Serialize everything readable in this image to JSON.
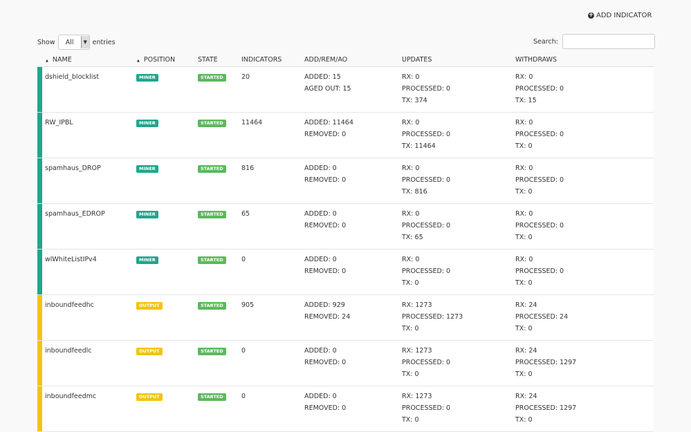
{
  "toolbar": {
    "add_indicator": "ADD INDICATOR",
    "show": "Show",
    "entries": "entries",
    "length_value": "All",
    "search_label": "Search:",
    "search_value": ""
  },
  "columns": [
    "NAME",
    "POSITION",
    "STATE",
    "INDICATORS",
    "ADD/REM/AO",
    "UPDATES",
    "WITHDRAWS"
  ],
  "colors": {
    "miner": "#1fa68b",
    "output": "#f2c40f",
    "started": "#5cb85c"
  },
  "rows": [
    {
      "name": "dshield_blocklist",
      "position": "MINER",
      "state": "STARTED",
      "indicators": "20",
      "addrem": [
        "ADDED: 15",
        "AGED OUT: 15"
      ],
      "updates": [
        "RX: 0",
        "PROCESSED: 0",
        "TX: 374"
      ],
      "withdraws": [
        "RX: 0",
        "PROCESSED: 0",
        "TX: 15"
      ]
    },
    {
      "name": "RW_IPBL",
      "position": "MINER",
      "state": "STARTED",
      "indicators": "11464",
      "addrem": [
        "ADDED: 11464",
        "REMOVED: 0"
      ],
      "updates": [
        "RX: 0",
        "PROCESSED: 0",
        "TX: 11464"
      ],
      "withdraws": [
        "RX: 0",
        "PROCESSED: 0",
        "TX: 0"
      ]
    },
    {
      "name": "spamhaus_DROP",
      "position": "MINER",
      "state": "STARTED",
      "indicators": "816",
      "addrem": [
        "ADDED: 0",
        "REMOVED: 0"
      ],
      "updates": [
        "RX: 0",
        "PROCESSED: 0",
        "TX: 816"
      ],
      "withdraws": [
        "RX: 0",
        "PROCESSED: 0",
        "TX: 0"
      ]
    },
    {
      "name": "spamhaus_EDROP",
      "position": "MINER",
      "state": "STARTED",
      "indicators": "65",
      "addrem": [
        "ADDED: 0",
        "REMOVED: 0"
      ],
      "updates": [
        "RX: 0",
        "PROCESSED: 0",
        "TX: 65"
      ],
      "withdraws": [
        "RX: 0",
        "PROCESSED: 0",
        "TX: 0"
      ]
    },
    {
      "name": "wlWhiteListIPv4",
      "position": "MINER",
      "state": "STARTED",
      "indicators": "0",
      "addrem": [
        "ADDED: 0",
        "REMOVED: 0"
      ],
      "updates": [
        "RX: 0",
        "PROCESSED: 0",
        "TX: 0"
      ],
      "withdraws": [
        "RX: 0",
        "PROCESSED: 0",
        "TX: 0"
      ]
    },
    {
      "name": "inboundfeedhc",
      "position": "OUTPUT",
      "state": "STARTED",
      "indicators": "905",
      "addrem": [
        "ADDED: 929",
        "REMOVED: 24"
      ],
      "updates": [
        "RX: 1273",
        "PROCESSED: 1273",
        "TX: 0"
      ],
      "withdraws": [
        "RX: 24",
        "PROCESSED: 24",
        "TX: 0"
      ]
    },
    {
      "name": "inboundfeedlc",
      "position": "OUTPUT",
      "state": "STARTED",
      "indicators": "0",
      "addrem": [
        "ADDED: 0",
        "REMOVED: 0"
      ],
      "updates": [
        "RX: 1273",
        "PROCESSED: 0",
        "TX: 0"
      ],
      "withdraws": [
        "RX: 24",
        "PROCESSED: 1297",
        "TX: 0"
      ]
    },
    {
      "name": "inboundfeedmc",
      "position": "OUTPUT",
      "state": "STARTED",
      "indicators": "0",
      "addrem": [
        "ADDED: 0",
        "REMOVED: 0"
      ],
      "updates": [
        "RX: 1273",
        "PROCESSED: 0",
        "TX: 0"
      ],
      "withdraws": [
        "RX: 24",
        "PROCESSED: 1297",
        "TX: 0"
      ]
    }
  ]
}
